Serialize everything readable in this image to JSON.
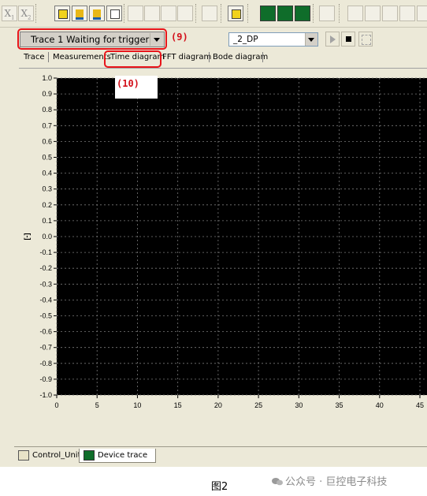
{
  "toolbar": {
    "x1_label": "X",
    "x1_sub": "1",
    "x2_label": "X",
    "x2_sub": "2"
  },
  "trace_select": {
    "value": "Trace 1 Waiting for trigger"
  },
  "callouts": {
    "nine": "(9)",
    "ten": "(10)"
  },
  "dp_select": {
    "value": "_2_DP"
  },
  "tabs": [
    "Trace",
    "Measurements",
    "Time diagram",
    "FFT diagram",
    "Bode diagram"
  ],
  "colors": {
    "highlight": "#e8141a",
    "plot_bg": "#000000",
    "grid": "#7a7a7a"
  },
  "chart_data": {
    "type": "line",
    "ylabel": "[-]",
    "ylim": [
      -1.0,
      1.0
    ],
    "yticks": [
      "1.0",
      "0.9",
      "0.8",
      "0.7",
      "0.6",
      "0.5",
      "0.4",
      "0.3",
      "0.2",
      "0.1",
      "0.0",
      "-0.1",
      "-0.2",
      "-0.3",
      "-0.4",
      "-0.5",
      "-0.6",
      "-0.7",
      "-0.8",
      "-0.9",
      "-1.0"
    ],
    "xticks": [
      "0",
      "5",
      "10",
      "15",
      "20",
      "25",
      "30",
      "35",
      "40",
      "45"
    ],
    "xlim": [
      0,
      45
    ],
    "grid": true,
    "series": []
  },
  "bottom_tabs": [
    "Control_Unit",
    "Device trace"
  ],
  "caption": "图2",
  "watermark": "公众号 · 巨控电子科技"
}
